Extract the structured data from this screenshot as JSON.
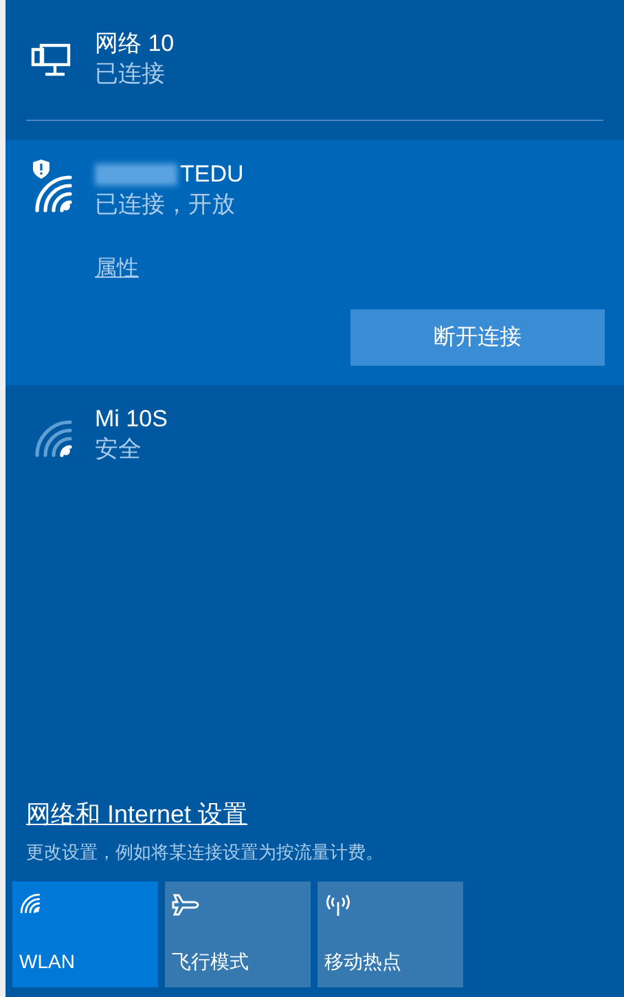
{
  "networks": [
    {
      "kind": "ethernet",
      "name": "网络 10",
      "status": "已连接",
      "selected": false
    },
    {
      "kind": "wifi",
      "name": "TEDU",
      "redacted": true,
      "status": "已连接，开放",
      "selected": true,
      "connected": true,
      "open_warning": true,
      "properties_link": "属性",
      "action_button": "断开连接"
    },
    {
      "kind": "wifi",
      "name": "Mi 10S",
      "status": "安全",
      "selected": false,
      "connected": false,
      "open_warning": false
    }
  ],
  "settings": {
    "link": "网络和 Internet 设置",
    "description": "更改设置，例如将某连接设置为按流量计费。"
  },
  "tiles": [
    {
      "kind": "wifi",
      "label": "WLAN",
      "on": true
    },
    {
      "kind": "airplane",
      "label": "飞行模式",
      "on": false
    },
    {
      "kind": "hotspot",
      "label": "移动热点",
      "on": false
    }
  ]
}
